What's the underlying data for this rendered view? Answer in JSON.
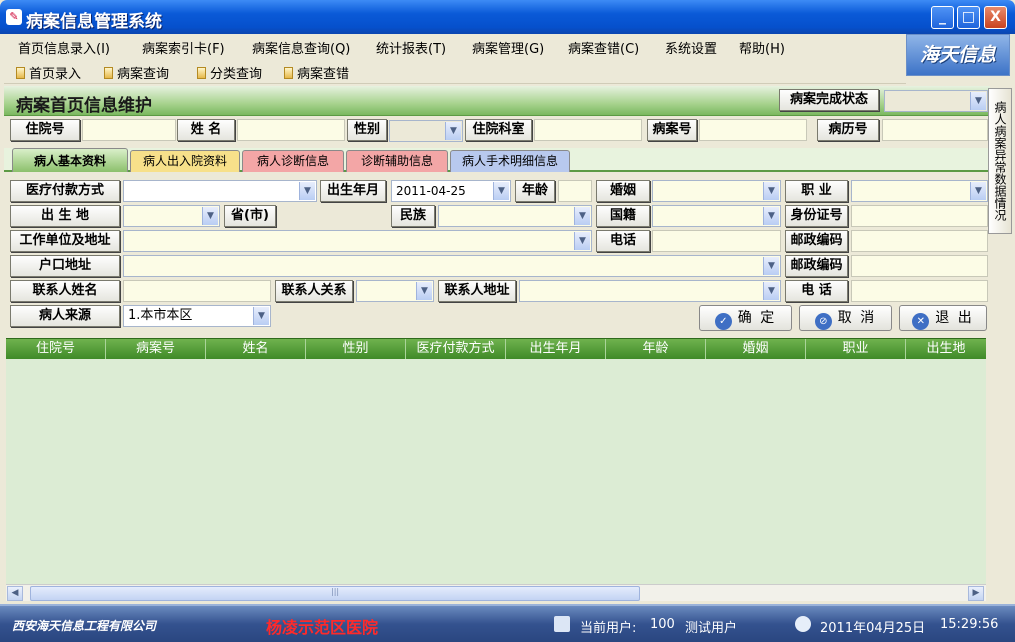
{
  "window": {
    "title": "病案信息管理系统",
    "min": "_",
    "max": "□",
    "close": "X",
    "icon": "record-icon"
  },
  "menu": [
    "首页信息录入(I)",
    "病案索引卡(F)",
    "病案信息查询(Q)",
    "统计报表(T)",
    "病案管理(G)",
    "病案查错(C)",
    "系统设置",
    "帮助(H)"
  ],
  "logo": "海天信息",
  "toolbar": [
    "首页录入",
    "病案查询",
    "分类查询",
    "病案查错"
  ],
  "header": {
    "title": "病案首页信息维护",
    "status_label": "病案完成状态"
  },
  "search": {
    "inpatient_no": "住院号",
    "name": "姓 名",
    "gender": "性别",
    "dept": "住院科室",
    "case_no": "病案号",
    "record_no": "病历号"
  },
  "tabs": [
    "病人基本资料",
    "病人出入院资料",
    "病人诊断信息",
    "诊断辅助信息",
    "病人手术明细信息"
  ],
  "tab_colors": [
    "#8cc06c",
    "#f7e08a",
    "#f3a6a6",
    "#f3a6a6",
    "#b8c9ee"
  ],
  "form": {
    "payment": "医疗付款方式",
    "birth_date_label": "出生年月",
    "birth_date": "2011-04-25",
    "age": "年龄",
    "marriage": "婚姻",
    "occupation": "职 业",
    "birthplace": "出 生 地",
    "province": "省(市)",
    "ethnicity": "民族",
    "nationality": "国籍",
    "id_card": "身份证号",
    "work_unit": "工作单位及地址",
    "phone": "电话",
    "postcode": "邮政编码",
    "household": "户口地址",
    "postcode2": "邮政编码",
    "contact_name": "联系人姓名",
    "contact_rel": "联系人关系",
    "contact_addr": "联系人地址",
    "contact_phone": "电 话",
    "source": "病人来源",
    "source_value": "1.本市本区"
  },
  "buttons": {
    "ok": "确 定",
    "cancel": "取 消",
    "exit": "退 出"
  },
  "grid_columns": [
    "住院号",
    "病案号",
    "姓名",
    "性别",
    "医疗付款方式",
    "出生年月",
    "年龄",
    "婚姻",
    "职业",
    "出生地"
  ],
  "side_tab": "病人病案异常数据情况",
  "statusbar": {
    "company": "西安海天信息工程有限公司",
    "hospital": "杨凌示范区医院",
    "user_label": "当前用户:",
    "user_id": "100",
    "user_name": "测试用户",
    "date": "2011年04月25日",
    "time": "15:29:56"
  },
  "scroll_marker": "|||"
}
